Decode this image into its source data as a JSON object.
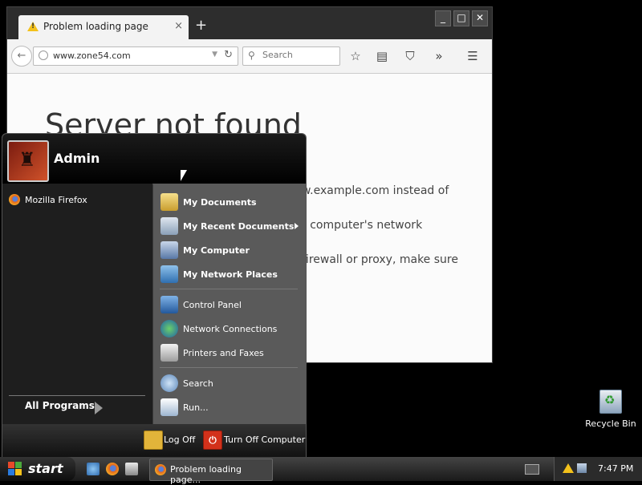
{
  "browser": {
    "tab_title": "Problem loading page",
    "tab_close_glyph": "×",
    "new_tab_glyph": "+",
    "window_buttons": {
      "minimize": "_",
      "maximize": "□",
      "close": "✕"
    },
    "url": "www.zone54.com",
    "search_placeholder": "Search",
    "page": {
      "heading": "Server not found",
      "lines": [
        "w.example.com instead of",
        "r computer's network",
        "firewall or proxy, make sure"
      ]
    }
  },
  "start_menu": {
    "username": "Admin",
    "pinned": [
      {
        "label": "Mozilla Firefox",
        "icon": "firefox-icon"
      }
    ],
    "all_programs": "All Programs",
    "right_items": [
      {
        "label": "My Documents",
        "bold": true,
        "icon": "my-documents-icon"
      },
      {
        "label": "My Recent Documents",
        "bold": true,
        "icon": "recent-documents-icon",
        "submenu": true
      },
      {
        "label": "My Computer",
        "bold": true,
        "icon": "my-computer-icon"
      },
      {
        "label": "My Network Places",
        "bold": true,
        "icon": "network-places-icon"
      },
      {
        "label": "Control Panel",
        "bold": false,
        "icon": "control-panel-icon"
      },
      {
        "label": "Network Connections",
        "bold": false,
        "icon": "network-connections-icon"
      },
      {
        "label": "Printers and Faxes",
        "bold": false,
        "icon": "printer-icon"
      },
      {
        "label": "Search",
        "bold": false,
        "icon": "search-icon"
      },
      {
        "label": "Run...",
        "bold": false,
        "icon": "run-icon"
      }
    ],
    "log_off": "Log Off",
    "turn_off": "Turn Off Computer"
  },
  "desktop": {
    "recycle_bin": "Recycle Bin"
  },
  "taskbar": {
    "start_label": "start",
    "task_label": "Problem loading page...",
    "clock": "7:47 PM"
  },
  "colors": {
    "warning": "#f3c11b",
    "start_menu_right": "#5a5a5a",
    "start_menu_left": "#1e1e1e"
  }
}
